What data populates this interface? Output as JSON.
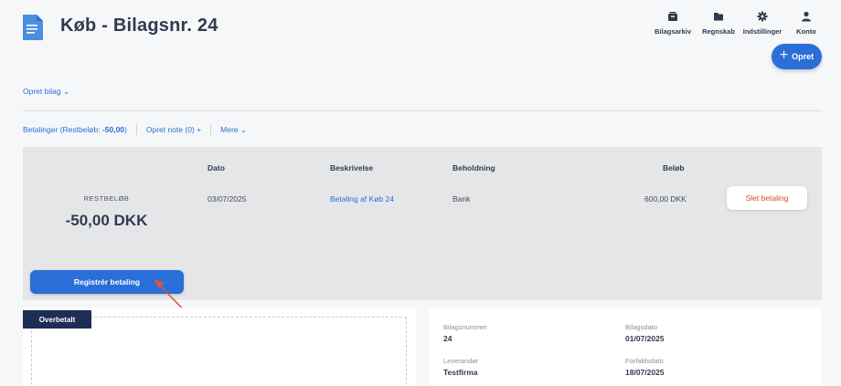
{
  "header": {
    "title": "Køb - Bilagsnr. 24",
    "nav": [
      {
        "label": "Bilagsarkiv",
        "icon": "archive-icon"
      },
      {
        "label": "Regnskab",
        "icon": "folder-icon"
      },
      {
        "label": "Indstillinger",
        "icon": "gear-icon"
      },
      {
        "label": "Konto",
        "icon": "user-icon"
      }
    ],
    "create_label": "Opret"
  },
  "actions": {
    "opret_bilag": "Opret bilag ⌄"
  },
  "subnav": {
    "betalinger_prefix": "Betalinger (Restbeløb: ",
    "betalinger_amount": "-50,00",
    "betalinger_suffix": ")",
    "opret_note": "Opret note (0) +",
    "mere": "Mere ⌄"
  },
  "payments": {
    "rest_label": "RESTBELØB",
    "rest_amount": "-50,00 DKK",
    "columns": {
      "dato": "Dato",
      "beskrivelse": "Beskrivelse",
      "beholdning": "Beholdning",
      "belob": "Beløb"
    },
    "row": {
      "dato": "03/07/2025",
      "beskrivelse": "Betaling af Køb 24",
      "beholdning": "Bank",
      "belob": "600,00 DKK"
    },
    "delete_label": "Slet betaling",
    "register_label": "Registrér betaling"
  },
  "overpaid": {
    "tag": "Overbetalt"
  },
  "details": {
    "bilagsnummer_label": "Bilagsnummer",
    "bilagsnummer_value": "24",
    "bilagsdato_label": "Bilagsdato",
    "bilagsdato_value": "01/07/2025",
    "leverandor_label": "Leverandør",
    "leverandor_value": "Testfirma",
    "forfaldsdato_label": "Forfaldsdato",
    "forfaldsdato_value": "18/07/2025"
  },
  "colors": {
    "accent": "#2a6fd8",
    "danger": "#d9472b",
    "navy": "#1d2d55",
    "annotation": "#e0533c"
  }
}
